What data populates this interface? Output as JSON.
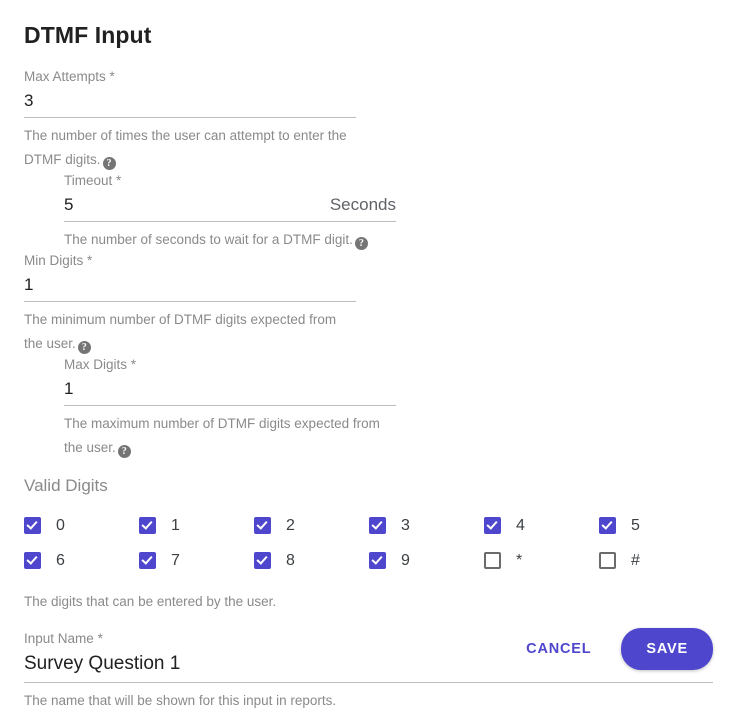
{
  "dialog": {
    "title": "DTMF Input"
  },
  "fields": [
    {
      "label": "Max Attempts",
      "required_mark": "*",
      "value": "3",
      "suffix": "",
      "hint": "The number of times the user can attempt to enter the DTMF digits.",
      "help_icon": "help-icon",
      "has_help": true
    },
    {
      "label": "Timeout",
      "required_mark": "*",
      "value": "5",
      "suffix": "Seconds",
      "hint": "The number of seconds to wait for a DTMF digit.",
      "help_icon": "help-icon",
      "has_help": true
    },
    {
      "label": "Min Digits",
      "required_mark": "*",
      "value": "1",
      "suffix": "",
      "hint": "The minimum number of DTMF digits expected from the user.",
      "help_icon": "help-icon",
      "has_help": true
    },
    {
      "label": "Max Digits",
      "required_mark": "*",
      "value": "1",
      "suffix": "",
      "hint": "The maximum number of DTMF digits expected from the user.",
      "help_icon": "help-icon",
      "has_help": true
    }
  ],
  "valid_digits": {
    "section_label": "Valid Digits",
    "hint": "The digits that can be entered by the user.",
    "items": [
      {
        "label": "0",
        "checked": true
      },
      {
        "label": "1",
        "checked": true
      },
      {
        "label": "2",
        "checked": true
      },
      {
        "label": "3",
        "checked": true
      },
      {
        "label": "4",
        "checked": true
      },
      {
        "label": "5",
        "checked": true
      },
      {
        "label": "6",
        "checked": true
      },
      {
        "label": "7",
        "checked": true
      },
      {
        "label": "8",
        "checked": true
      },
      {
        "label": "9",
        "checked": true
      },
      {
        "label": "*",
        "checked": false
      },
      {
        "label": "#",
        "checked": false
      }
    ]
  },
  "input_name": {
    "label": "Input Name",
    "required_mark": "*",
    "value": "Survey Question 1",
    "hint": "The name that will be shown for this input in reports."
  },
  "footer": {
    "cancel_label": "CANCEL",
    "save_label": "SAVE"
  },
  "colors": {
    "accent": "#4f46ce",
    "label_gray": "#8a8a8a",
    "text": "#212121",
    "underline": "#bdbdbd"
  }
}
